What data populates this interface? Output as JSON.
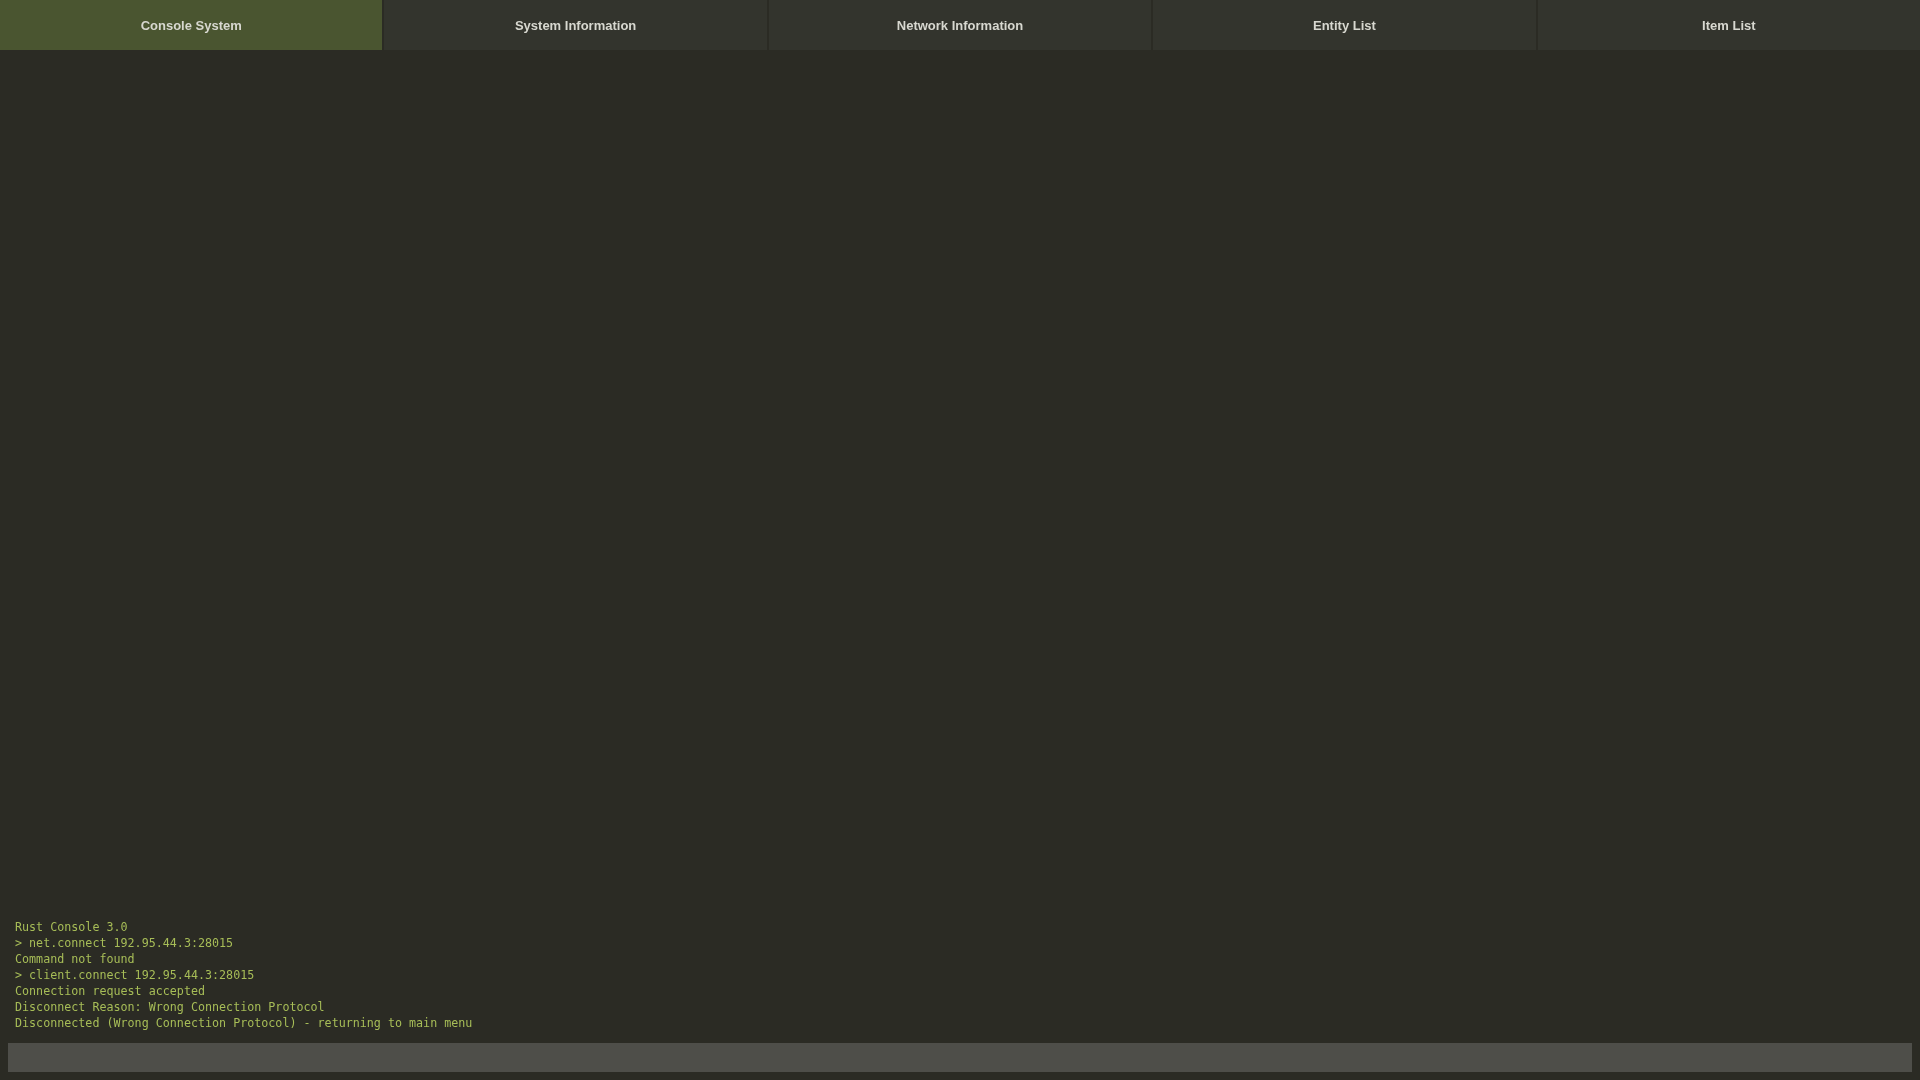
{
  "tabs": [
    {
      "label": "Console System",
      "selected": true
    },
    {
      "label": "System Information",
      "selected": false
    },
    {
      "label": "Network Information",
      "selected": false
    },
    {
      "label": "Entity List",
      "selected": false
    },
    {
      "label": "Item List",
      "selected": false
    }
  ],
  "console": {
    "lines": [
      "Rust Console 3.0",
      "> net.connect 192.95.44.3:28015",
      "Command not found",
      "> client.connect 192.95.44.3:28015",
      "Connection request accepted",
      "Disconnect Reason: Wrong Connection Protocol",
      "Disconnected (Wrong Connection Protocol) - returning to main menu"
    ]
  }
}
